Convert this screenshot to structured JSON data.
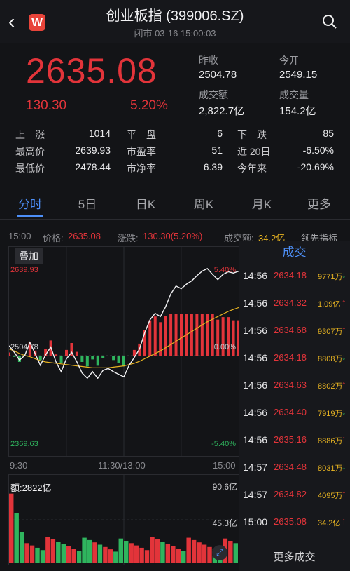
{
  "header": {
    "title": "创业板指 (399006.SZ)",
    "subtitle": "闭市 03-16 15:00:03",
    "logo_letter": "W"
  },
  "quote": {
    "price": "2635.08",
    "change": "130.30",
    "change_pct": "5.20%",
    "prev_close_label": "昨收",
    "prev_close": "2504.78",
    "open_label": "今开",
    "open": "2549.15",
    "turnover_label": "成交额",
    "turnover": "2,822.7亿",
    "volume_label": "成交量",
    "volume": "154.2亿"
  },
  "stats": {
    "rise_label": "上　涨",
    "rise": "1014",
    "flat_label": "平　盘",
    "flat": "6",
    "fall_label": "下　跌",
    "fall": "85",
    "high_label": "最高价",
    "high": "2639.93",
    "pe_label": "市盈率",
    "pe": "51",
    "d20_label": "近 20日",
    "d20": "-6.50%",
    "low_label": "最低价",
    "low": "2478.44",
    "pb_label": "市净率",
    "pb": "6.39",
    "ytd_label": "今年来",
    "ytd": "-20.69%"
  },
  "tabs": [
    "分时",
    "5日",
    "日K",
    "周K",
    "月K",
    "更多"
  ],
  "info_line": {
    "time": "15:00",
    "price_label": "价格:",
    "price": "2635.08",
    "chg_label": "涨跌:",
    "chg": "130.30(5.20%)",
    "amt_label": "成交额:",
    "amt": "34.2亿",
    "indicator": "领先指标"
  },
  "chart": {
    "overlay_label": "叠加",
    "top_price": "2639.93",
    "top_pct": "5.40%",
    "mid_price": "2504.78",
    "mid_pct": "0.00%",
    "bottom_price": "2369.63",
    "bottom_pct": "-5.40%",
    "time_start": "9:30",
    "time_mid": "11:30/13:00",
    "time_end": "15:00",
    "vol_label": "额:2822亿",
    "vol_max": "90.6亿",
    "vol_mid": "45.3亿"
  },
  "chart_data": {
    "type": "line",
    "x_range": [
      "9:30",
      "15:00"
    ],
    "ylim": [
      2369.63,
      2639.93
    ],
    "prev_close": 2504.78,
    "price": [
      2520,
      2510,
      2498,
      2505,
      2525,
      2508,
      2490,
      2506,
      2518,
      2495,
      2480,
      2500,
      2510,
      2495,
      2478,
      2470,
      2480,
      2470,
      2482,
      2485,
      2480,
      2476,
      2472,
      2490,
      2502,
      2515,
      2540,
      2560,
      2570,
      2565,
      2580,
      2600,
      2612,
      2608,
      2615,
      2620,
      2628,
      2635,
      2639,
      2630,
      2622,
      2630,
      2634,
      2632,
      2635
    ],
    "avg": [
      2515,
      2512,
      2508,
      2505,
      2503,
      2500,
      2497,
      2495,
      2494,
      2493,
      2492,
      2491,
      2490,
      2489,
      2488,
      2487,
      2486,
      2486,
      2486,
      2486,
      2487,
      2488,
      2489,
      2491,
      2493,
      2496,
      2500,
      2504,
      2508,
      2512,
      2517,
      2522,
      2527,
      2532,
      2537,
      2542,
      2547,
      2552,
      2557,
      2561,
      2565,
      2569,
      2573,
      2576,
      2579
    ]
  },
  "trades_title": "成交",
  "trades": [
    {
      "time": "14:56",
      "price": "2634.18",
      "vol": "9771万",
      "dir": "down"
    },
    {
      "time": "14:56",
      "price": "2634.32",
      "vol": "1.09亿",
      "dir": "up"
    },
    {
      "time": "14:56",
      "price": "2634.68",
      "vol": "9307万",
      "dir": "up"
    },
    {
      "time": "14:56",
      "price": "2634.18",
      "vol": "8808万",
      "dir": "down"
    },
    {
      "time": "14:56",
      "price": "2634.63",
      "vol": "8802万",
      "dir": "up"
    },
    {
      "time": "14:56",
      "price": "2634.40",
      "vol": "7919万",
      "dir": "down"
    },
    {
      "time": "14:56",
      "price": "2635.16",
      "vol": "8886万",
      "dir": "up"
    },
    {
      "time": "14:57",
      "price": "2634.48",
      "vol": "8031万",
      "dir": "down"
    },
    {
      "time": "14:57",
      "price": "2634.82",
      "vol": "4095万",
      "dir": "up"
    },
    {
      "time": "15:00",
      "price": "2635.08",
      "vol": "34.2亿",
      "dir": "up"
    }
  ],
  "more_trades": "更多成交",
  "colors": {
    "up": "#e2343a",
    "down": "#2fb55e",
    "accent": "#4d8ff7"
  }
}
